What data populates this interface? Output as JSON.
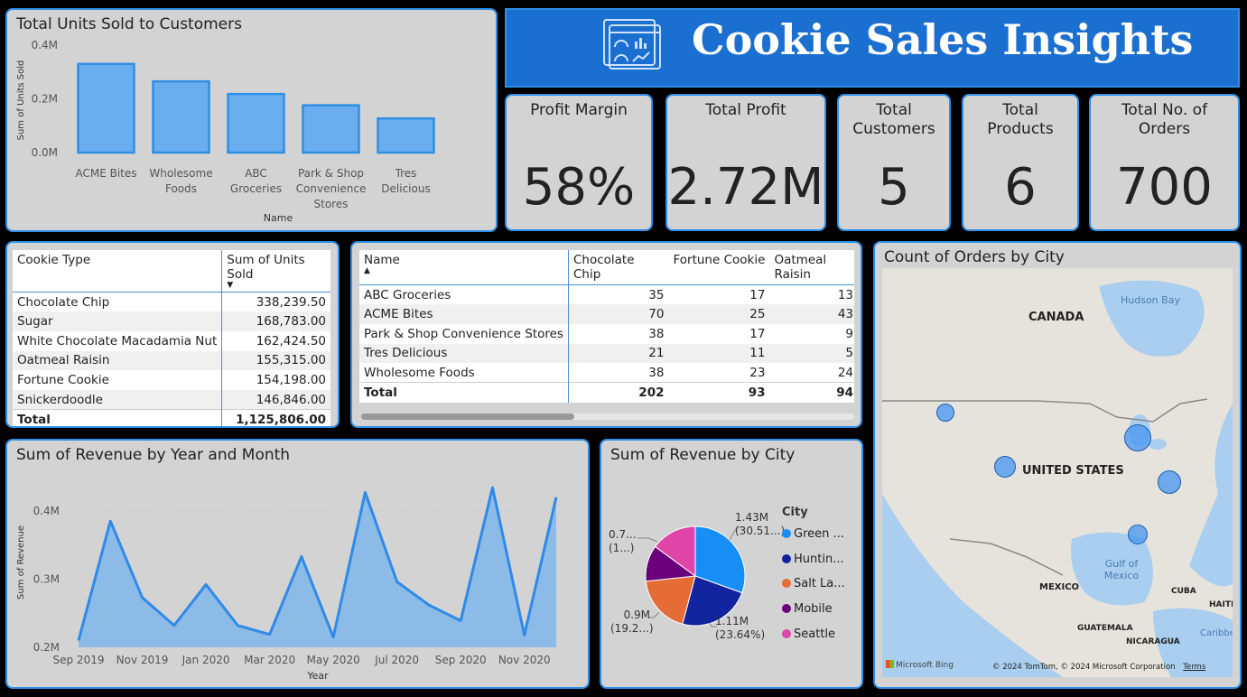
{
  "header": {
    "title": "Cookie Sales Insights",
    "icon": "dashboard-icon"
  },
  "kpis": [
    {
      "label": "Profit Margin",
      "value": "58%"
    },
    {
      "label": "Total Profit",
      "value": "2.72M"
    },
    {
      "label": "Total Customers",
      "value": "5"
    },
    {
      "label": "Total Products",
      "value": "6"
    },
    {
      "label": "Total No. of Orders",
      "value": "700"
    }
  ],
  "units_chart": {
    "title": "Total Units Sold to Customers",
    "ylabel": "Sum of Units Sold",
    "xlabel": "Name",
    "yticks": [
      "0.0M",
      "0.2M",
      "0.4M"
    ],
    "categories_lines": [
      [
        "ACME Bites"
      ],
      [
        "Wholesome",
        "Foods"
      ],
      [
        "ABC",
        "Groceries"
      ],
      [
        "Park & Shop",
        "Convenience",
        "Stores"
      ],
      [
        "Tres",
        "Delicious"
      ]
    ]
  },
  "cookie_table": {
    "headers": [
      "Cookie Type",
      "Sum of Units Sold"
    ],
    "rows": [
      [
        "Chocolate Chip",
        "338,239.50"
      ],
      [
        "Sugar",
        "168,783.00"
      ],
      [
        "White Chocolate Macadamia Nut",
        "162,424.50"
      ],
      [
        "Oatmeal Raisin",
        "155,315.00"
      ],
      [
        "Fortune Cookie",
        "154,198.00"
      ],
      [
        "Snickerdoodle",
        "146,846.00"
      ]
    ],
    "total": [
      "Total",
      "1,125,806.00"
    ]
  },
  "matrix_table": {
    "headers": [
      "Name",
      "Chocolate Chip",
      "Fortune Cookie",
      "Oatmeal Raisin"
    ],
    "rows": [
      [
        "ABC Groceries",
        "35",
        "17",
        "13"
      ],
      [
        "ACME Bites",
        "70",
        "25",
        "43"
      ],
      [
        "Park & Shop Convenience Stores",
        "38",
        "17",
        "9"
      ],
      [
        "Tres Delicious",
        "21",
        "11",
        "5"
      ],
      [
        "Wholesome Foods",
        "38",
        "23",
        "24"
      ]
    ],
    "total": [
      "Total",
      "202",
      "93",
      "94"
    ]
  },
  "revenue_chart": {
    "title": "Sum of Revenue by Year and Month",
    "ylabel": "Sum of Revenue",
    "xlabel": "Year",
    "yticks": [
      "0.2M",
      "0.3M",
      "0.4M"
    ],
    "xticks": [
      "Sep 2019",
      "Nov 2019",
      "Jan 2020",
      "Mar 2020",
      "May 2020",
      "Jul 2020",
      "Sep 2020",
      "Nov 2020"
    ]
  },
  "pie_chart": {
    "title": "Sum of Revenue by City",
    "legend_title": "City",
    "legend": [
      "Green ...",
      "Huntin...",
      "Salt La...",
      "Mobile",
      "Seattle"
    ],
    "labels": {
      "green": [
        "1.43M",
        "(30.51...)"
      ],
      "huntington": [
        "1.11M",
        "(23.64%)"
      ],
      "salt_lake": [
        "0.9M",
        "(19.2...)"
      ],
      "seattle": [
        "0.7...",
        "(1...)"
      ]
    }
  },
  "map": {
    "title": "Count of Orders by City",
    "labels": [
      "CANADA",
      "UNITED STATES",
      "MEXICO",
      "Hudson Bay",
      "Gulf of Mexico",
      "CUBA",
      "HAITI",
      "GUATEMALA",
      "NICARAGUA",
      "Caribbe"
    ],
    "credit": "© 2024 TomTom, © 2024 Microsoft Corporation",
    "terms": "Terms",
    "bing": "Microsoft Bing"
  },
  "chart_data": [
    {
      "type": "bar",
      "title": "Total Units Sold to Customers",
      "categories": [
        "ACME Bites",
        "Wholesome Foods",
        "ABC Groceries",
        "Park & Shop Convenience Stores",
        "Tres Delicious"
      ],
      "values": [
        0.33,
        0.265,
        0.218,
        0.176,
        0.127
      ],
      "xlabel": "Name",
      "ylabel": "Sum of Units Sold",
      "ylim": [
        0,
        0.4
      ],
      "units": "M",
      "color": "#6aaef0"
    },
    {
      "type": "area",
      "title": "Sum of Revenue by Year and Month",
      "x": [
        "Sep 2019",
        "Oct 2019",
        "Nov 2019",
        "Dec 2019",
        "Jan 2020",
        "Feb 2020",
        "Mar 2020",
        "Apr 2020",
        "May 2020",
        "Jun 2020",
        "Jul 2020",
        "Aug 2020",
        "Sep 2020",
        "Oct 2020",
        "Nov 2020",
        "Dec 2020"
      ],
      "values": [
        0.21,
        0.385,
        0.273,
        0.232,
        0.292,
        0.232,
        0.219,
        0.333,
        0.215,
        0.427,
        0.296,
        0.262,
        0.239,
        0.434,
        0.218,
        0.42
      ],
      "xlabel": "Year",
      "ylabel": "Sum of Revenue",
      "ylim": [
        0.2,
        0.45
      ],
      "units": "M",
      "color": "#2f8ae8"
    },
    {
      "type": "pie",
      "title": "Sum of Revenue by City",
      "categories": [
        "Green ...",
        "Huntin...",
        "Salt La...",
        "Mobile",
        "Seattle"
      ],
      "values": [
        1.43,
        1.11,
        0.9,
        0.55,
        0.7
      ],
      "colors": [
        "#168ef6",
        "#12239e",
        "#e66c37",
        "#6b007b",
        "#e044a7"
      ]
    }
  ]
}
